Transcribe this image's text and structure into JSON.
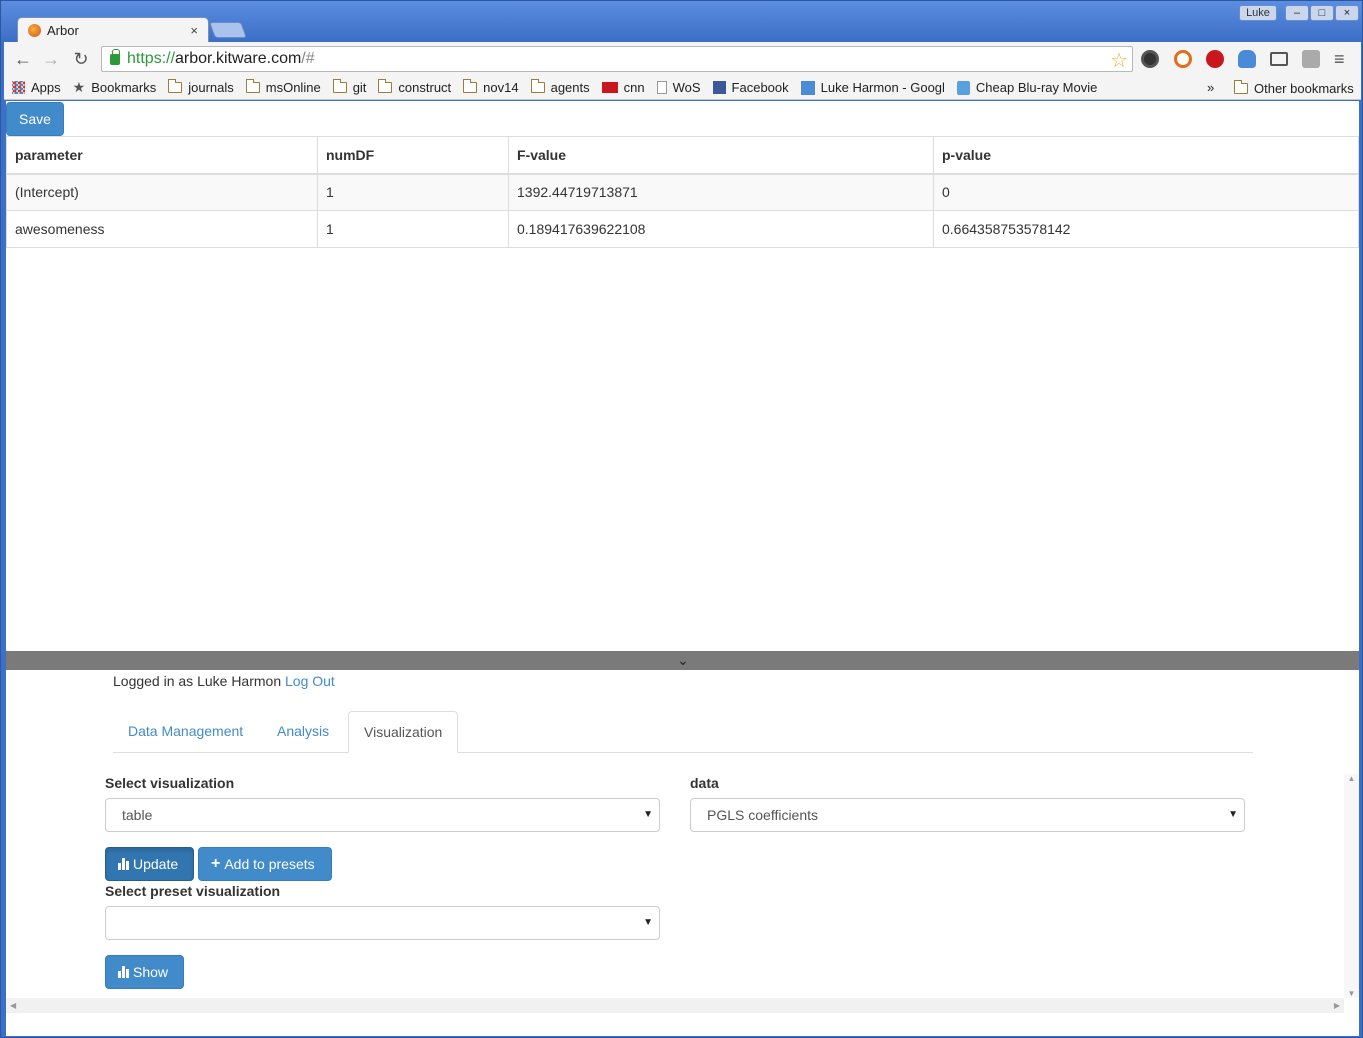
{
  "browser": {
    "tab_title": "Arbor",
    "tab_close": "×",
    "profile": "Luke",
    "window_controls": {
      "minimize": "–",
      "maximize": "□",
      "close": "×"
    },
    "url": {
      "scheme": "https://",
      "host": "arbor.kitware.com",
      "path": "/#"
    },
    "nav": {
      "back": "←",
      "forward": "→",
      "reload": "↻"
    },
    "star": "☆",
    "menu": "≡"
  },
  "bookmarks": {
    "items": [
      {
        "label": "Apps",
        "icon": "apps-icon"
      },
      {
        "label": "Bookmarks",
        "icon": "star-icon"
      },
      {
        "label": "journals",
        "icon": "folder-icon"
      },
      {
        "label": "msOnline",
        "icon": "folder-icon"
      },
      {
        "label": "git",
        "icon": "folder-icon"
      },
      {
        "label": "construct",
        "icon": "folder-icon"
      },
      {
        "label": "nov14",
        "icon": "folder-icon"
      },
      {
        "label": "agents",
        "icon": "folder-icon"
      },
      {
        "label": "cnn",
        "icon": "cnn-icon"
      },
      {
        "label": "WoS",
        "icon": "page-icon"
      },
      {
        "label": "Facebook",
        "icon": "facebook-icon"
      },
      {
        "label": "Luke Harmon - Googl",
        "icon": "google-scholar-icon"
      },
      {
        "label": "Cheap Blu-ray Movie",
        "icon": "b-icon"
      }
    ],
    "overflow": "»",
    "other": "Other bookmarks"
  },
  "page": {
    "save_label": "Save",
    "table": {
      "headers": [
        "parameter",
        "numDF",
        "F-value",
        "p-value"
      ],
      "rows": [
        [
          "(Intercept)",
          "1",
          "1392.44719713871",
          "0"
        ],
        [
          "awesomeness",
          "1",
          "0.189417639622108",
          "0.664358753578142"
        ]
      ]
    },
    "splitter_icon": "chevron-down-icon",
    "login": {
      "prefix": "Logged in as Luke Harmon",
      "logout": "Log Out"
    },
    "tabs": [
      "Data Management",
      "Analysis",
      "Visualization"
    ],
    "active_tab": "Visualization",
    "select_viz_label": "Select visualization",
    "select_viz_value": "table",
    "data_label": "data",
    "data_value": "PGLS coefficients",
    "update_label": "Update",
    "add_presets_label": "Add to presets",
    "preset_label": "Select preset visualization",
    "preset_value": "",
    "show_label": "Show"
  },
  "colors": {
    "primary": "#428bca",
    "primary_active": "#3276b1",
    "url_green": "#2d9a3a",
    "splitter": "#7a7a7a"
  }
}
